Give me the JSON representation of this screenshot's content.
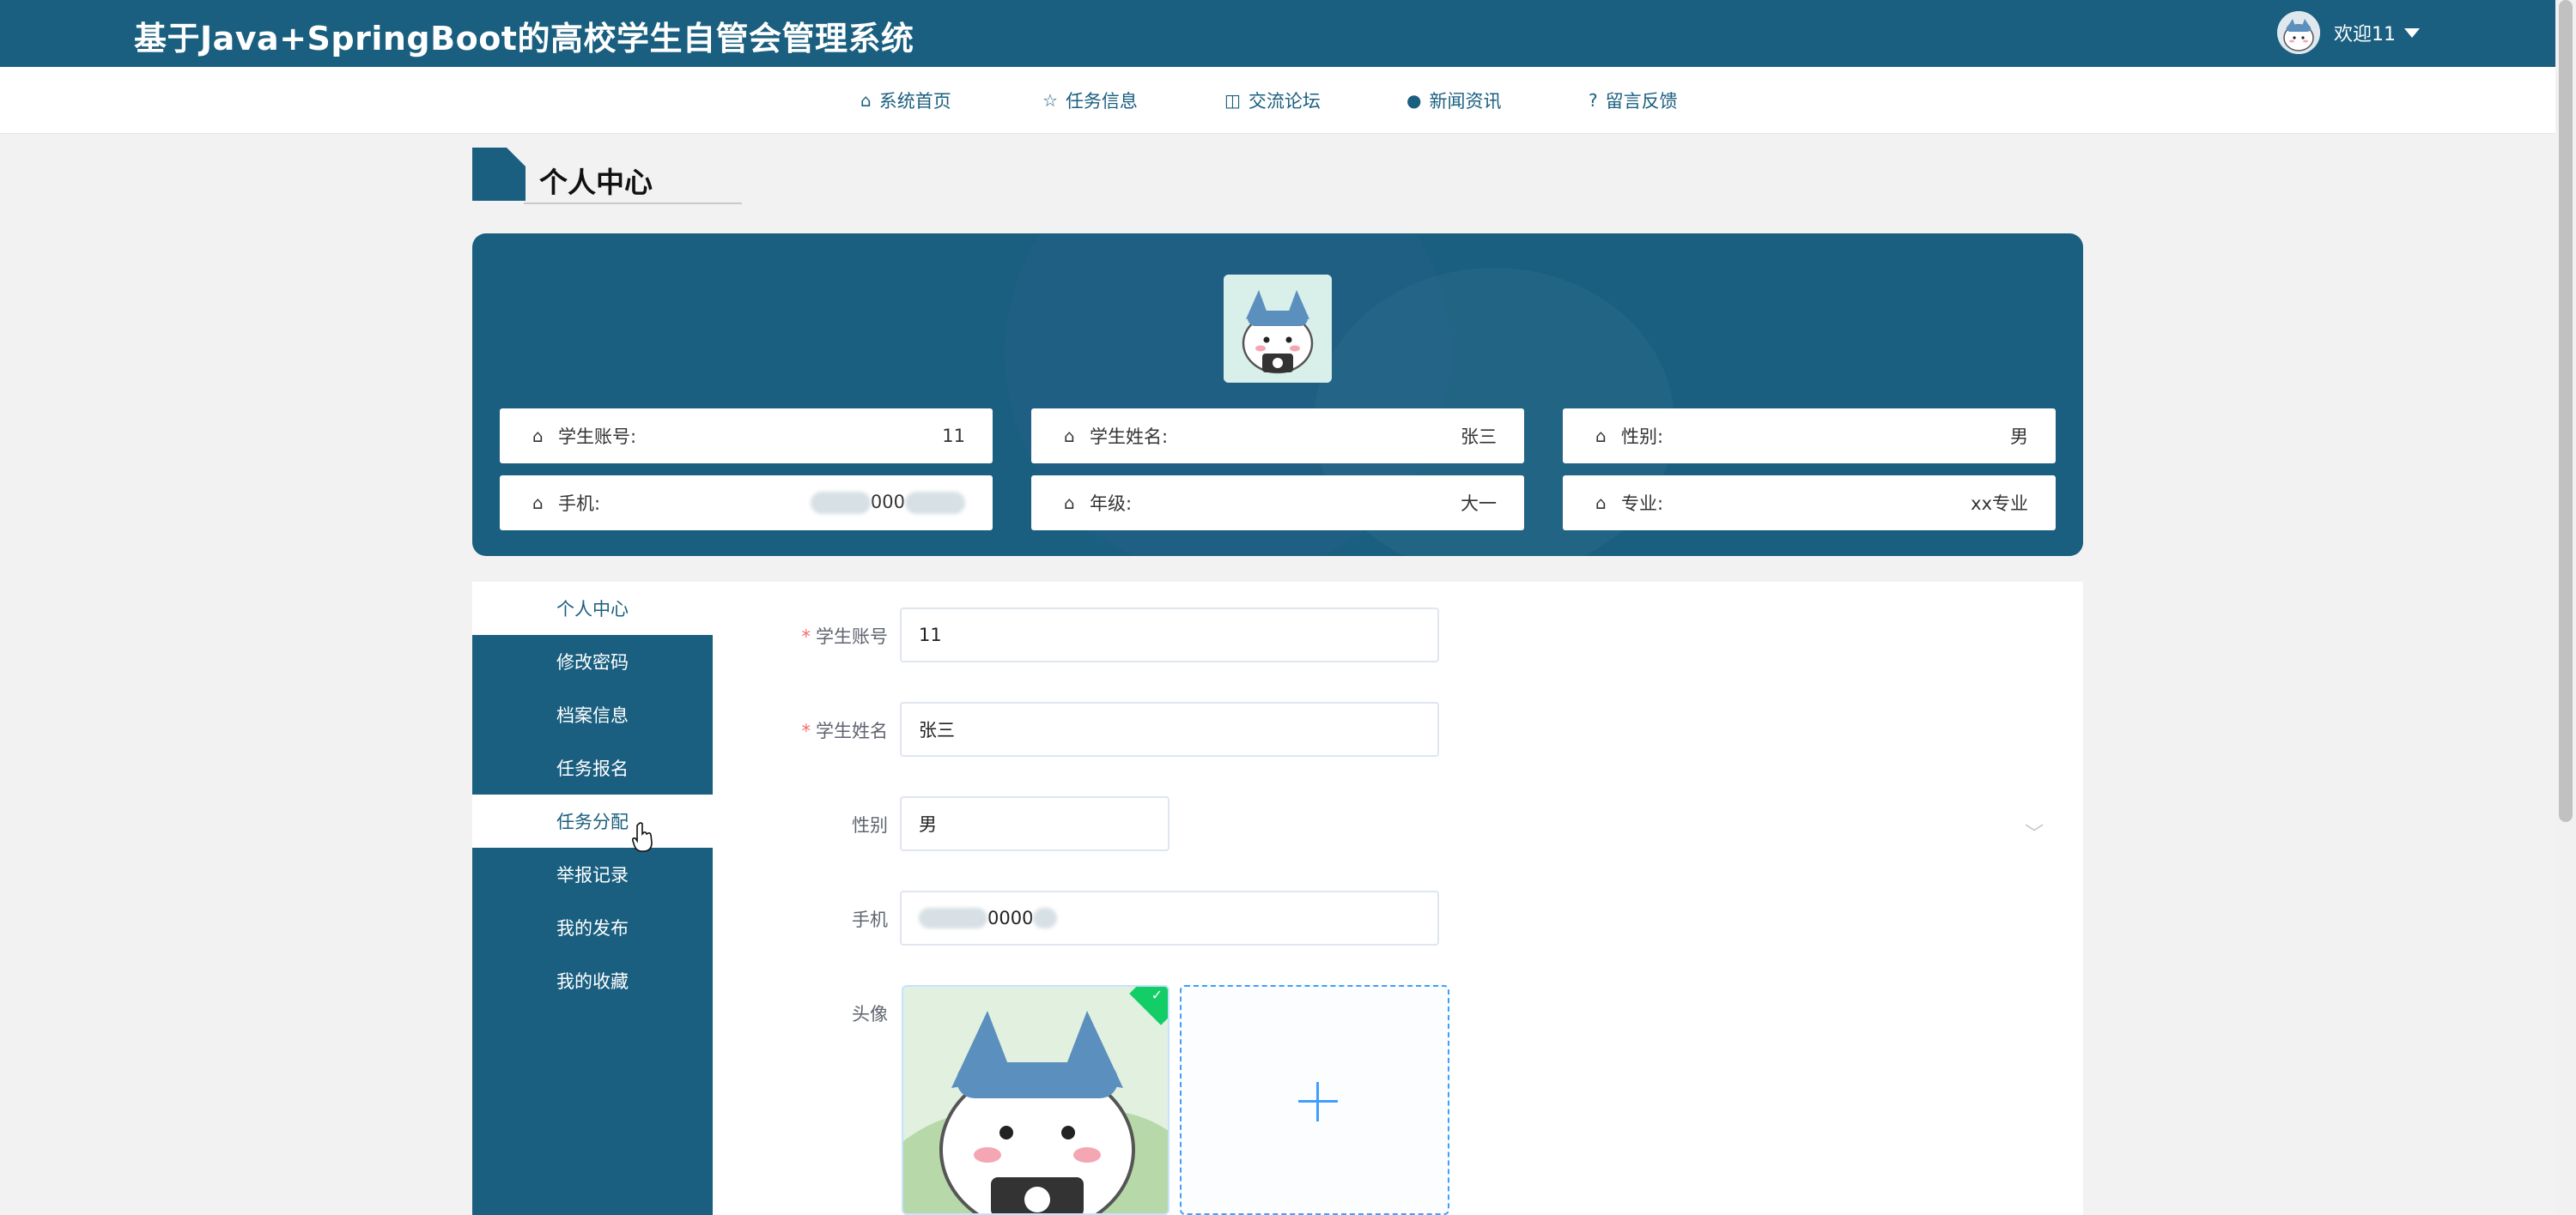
{
  "app": {
    "title": "基于Java+SpringBoot的高校学生自管会管理系统",
    "welcome": "欢迎11"
  },
  "nav": [
    {
      "label": "系统首页",
      "icon": "home-icon"
    },
    {
      "label": "任务信息",
      "icon": "star-icon"
    },
    {
      "label": "交流论坛",
      "icon": "bag-icon"
    },
    {
      "label": "新闻资讯",
      "icon": "alert-icon"
    },
    {
      "label": "留言反馈",
      "icon": "question-icon"
    }
  ],
  "page_title": "个人中心",
  "profile": {
    "account_label": "学生账号:",
    "account_value": "11",
    "name_label": "学生姓名:",
    "name_value": "张三",
    "gender_label": "性别:",
    "gender_value": "男",
    "phone_label": "手机:",
    "phone_value_visible": "000",
    "grade_label": "年级:",
    "grade_value": "大一",
    "major_label": "专业:",
    "major_value": "xx专业"
  },
  "menu": [
    "个人中心",
    "修改密码",
    "档案信息",
    "任务报名",
    "任务分配",
    "举报记录",
    "我的发布",
    "我的收藏"
  ],
  "form": {
    "account_label": "学生账号",
    "account_value": "11",
    "name_label": "学生姓名",
    "name_value": "张三",
    "gender_label": "性别",
    "gender_value": "男",
    "phone_label": "手机",
    "phone_value_visible": "0000",
    "avatar_label": "头像"
  },
  "colors": {
    "primary": "#1a5f7f",
    "background": "#f2f2f2",
    "upload_accent": "#409eff",
    "required": "#f56c6c"
  }
}
